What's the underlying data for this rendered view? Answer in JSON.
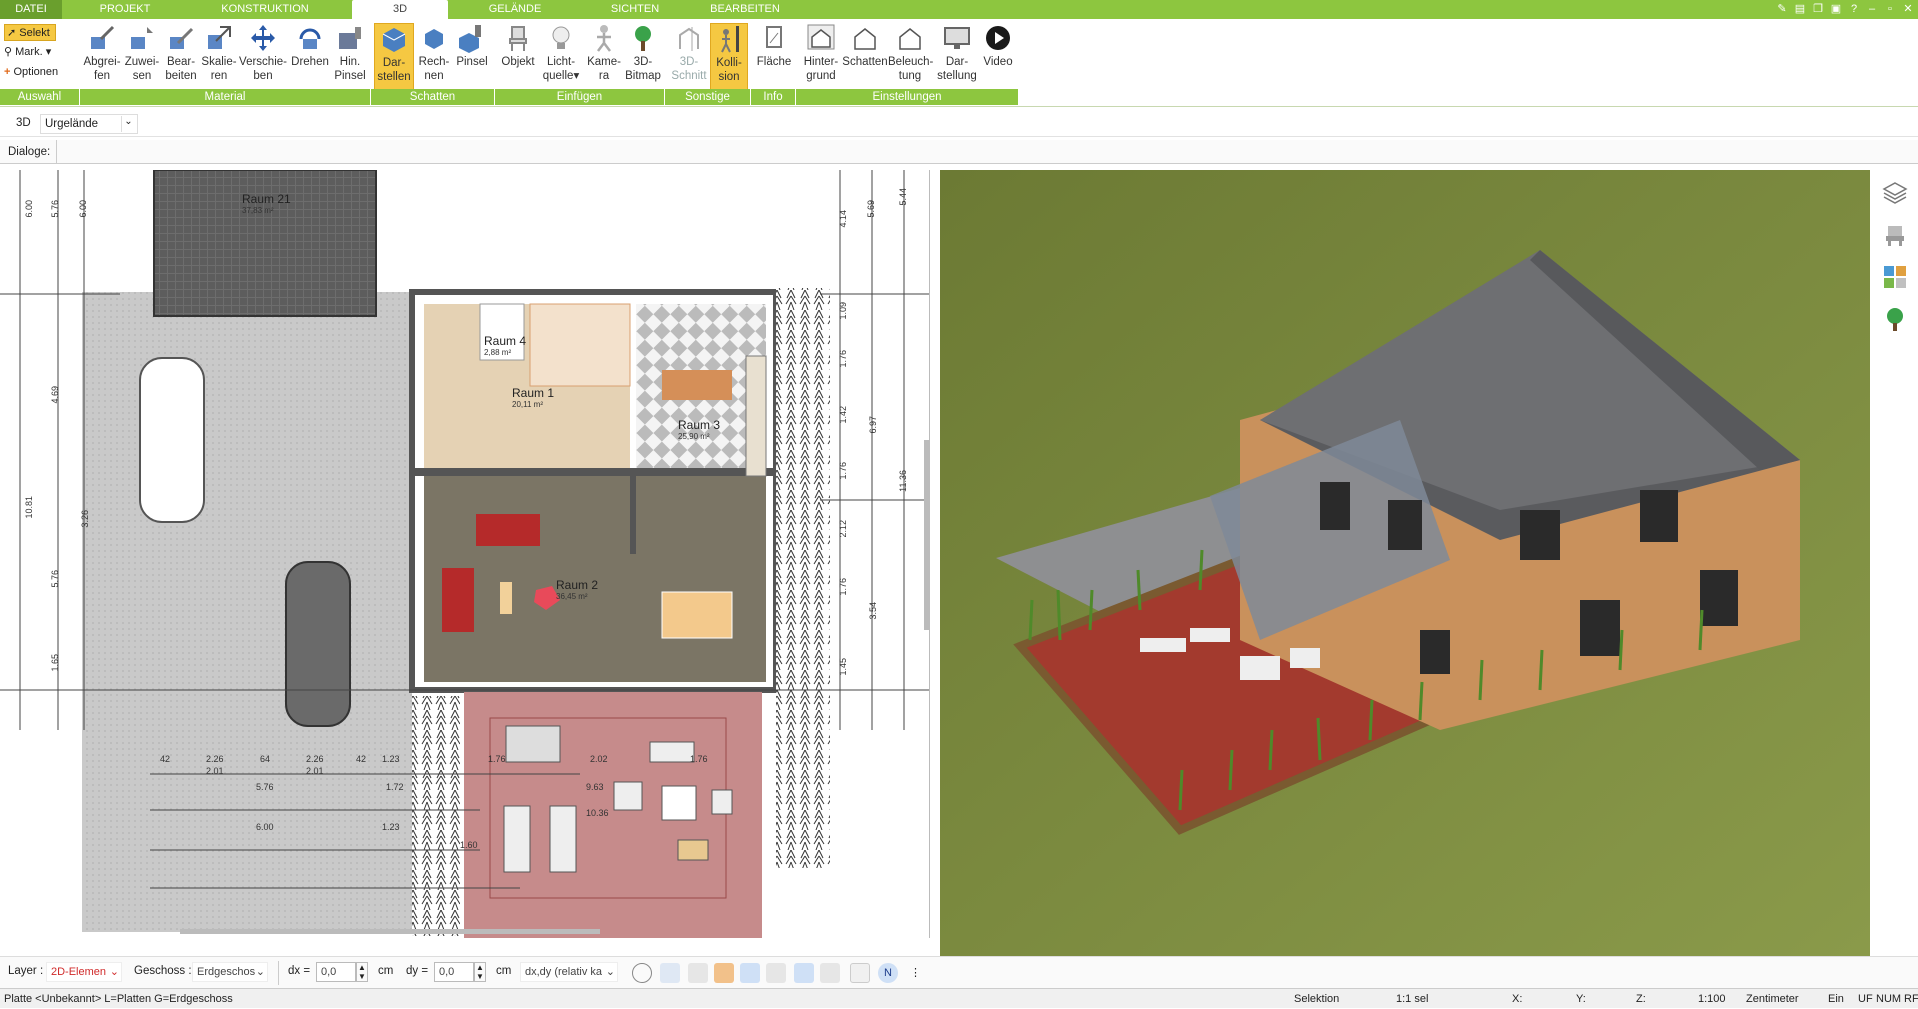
{
  "tabs": [
    "DATEI",
    "PROJEKT",
    "KONSTRUKTION",
    "3D",
    "GELÄNDE",
    "SICHTEN",
    "BEARBEITEN"
  ],
  "left_tools": {
    "select": "Selekt",
    "mark": "Mark.",
    "options": "Optionen"
  },
  "ribbon_buttons": [
    {
      "id": "abgreifen",
      "label1": "Abgrei-",
      "label2": "fen"
    },
    {
      "id": "zuweisen",
      "label1": "Zuwei-",
      "label2": "sen"
    },
    {
      "id": "bearbeiten",
      "label1": "Bear-",
      "label2": "beiten"
    },
    {
      "id": "skalieren",
      "label1": "Skalie-",
      "label2": "ren"
    },
    {
      "id": "verschieben",
      "label1": "Verschie-",
      "label2": "ben"
    },
    {
      "id": "drehen",
      "label1": "Drehen",
      "label2": ""
    },
    {
      "id": "hin-pinsel",
      "label1": "Hin.",
      "label2": "Pinsel"
    },
    {
      "id": "darstellen",
      "label1": "Dar-",
      "label2": "stellen"
    },
    {
      "id": "rechnen",
      "label1": "Rech-",
      "label2": "nen"
    },
    {
      "id": "pinsel",
      "label1": "Pinsel",
      "label2": ""
    },
    {
      "id": "objekt",
      "label1": "Objekt",
      "label2": ""
    },
    {
      "id": "lichtquelle",
      "label1": "Licht-",
      "label2": "quelle"
    },
    {
      "id": "kamera",
      "label1": "Kame-",
      "label2": "ra"
    },
    {
      "id": "3d-bitmap",
      "label1": "3D-",
      "label2": "Bitmap"
    },
    {
      "id": "3d-schnitt",
      "label1": "3D-",
      "label2": "Schnitt"
    },
    {
      "id": "kollision",
      "label1": "Kolli-",
      "label2": "sion"
    },
    {
      "id": "flaeche",
      "label1": "Fläche",
      "label2": ""
    },
    {
      "id": "hintergrund",
      "label1": "Hinter-",
      "label2": "grund"
    },
    {
      "id": "schatten",
      "label1": "Schatten",
      "label2": ""
    },
    {
      "id": "beleuchtung",
      "label1": "Beleuch-",
      "label2": "tung"
    },
    {
      "id": "darstellung",
      "label1": "Dar-",
      "label2": "stellung"
    },
    {
      "id": "video",
      "label1": "Video",
      "label2": ""
    }
  ],
  "groups": [
    "Auswahl",
    "Material",
    "Schatten",
    "Einfügen",
    "Sonstige",
    "Info",
    "Einstellungen"
  ],
  "toolbar2": {
    "mode": "3D",
    "terrain": "Urgelände"
  },
  "dialoge": "Dialoge:",
  "plan": {
    "rooms": [
      {
        "name": "Raum 21",
        "area": "37,83 m²"
      },
      {
        "name": "Raum 4",
        "area": "2,88 m²"
      },
      {
        "name": "Raum 1",
        "area": "20,11 m²"
      },
      {
        "name": "Raum 3",
        "area": "25,90 m²"
      },
      {
        "name": "Raum 2",
        "area": "36,45 m²"
      }
    ],
    "dims_left": [
      "6.00",
      "5.76",
      "6.00",
      "4.69",
      "10.81",
      "3.26",
      "5.76",
      "1.65"
    ],
    "dims_right": [
      "5.69",
      "5.44",
      "4.14",
      "1.09",
      "1.76",
      "1.42",
      "6.97",
      "1.76",
      "11.36",
      "2.12",
      "1.76",
      "3.54",
      "1.45"
    ],
    "dims_bottom": [
      "42",
      "2.26",
      "64",
      "2.26",
      "42",
      "1.23",
      "2.01",
      "2.01",
      "5.76",
      "1.72",
      "6.00",
      "1.23",
      "1.76",
      "2.02",
      "1.76",
      "9.63",
      "10.36",
      "1.60"
    ]
  },
  "bottom": {
    "layer_label": "Layer :",
    "layer_value": "2D-Elemen",
    "geschoss_label": "Geschoss :",
    "geschoss_value": "Erdgeschos",
    "dx_label": "dx =",
    "dx_value": "0,0",
    "dx_unit": "cm",
    "dy_label": "dy =",
    "dy_value": "0,0",
    "dy_unit": "cm",
    "mode_value": "dx,dy (relativ ka"
  },
  "status": {
    "left": "Platte <Unbekannt> L=Platten G=Erdgeschoss",
    "selektion": "Selektion",
    "sel": "1:1 sel",
    "x": "X:",
    "y": "Y:",
    "z": "Z:",
    "scale": "1:100",
    "unit": "Zentimeter",
    "ein": "Ein",
    "uf": "UF",
    "num": "NUM",
    "rf": "RF"
  },
  "colors": {
    "ribbon_green": "#8dc63f",
    "active_yellow": "#f5c842",
    "grass": "#7a8a3a",
    "terrace": "#9b3a30",
    "roof": "#6e6f72",
    "wall": "#c9915c"
  }
}
